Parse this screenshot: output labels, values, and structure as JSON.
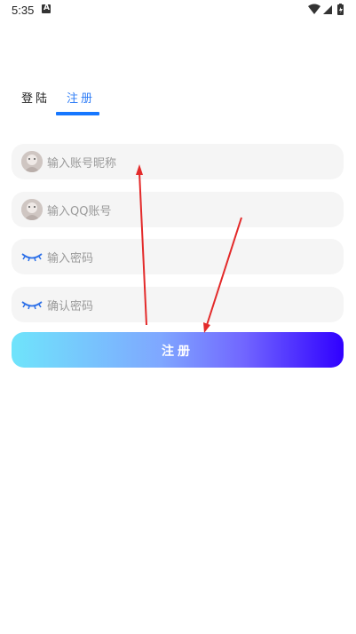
{
  "status_bar": {
    "time": "5:35",
    "notif": "A"
  },
  "tabs": {
    "login": "登陆",
    "register": "注册"
  },
  "form": {
    "nickname_placeholder": "输入账号昵称",
    "qq_placeholder": "输入QQ账号",
    "password_placeholder": "输入密码",
    "confirm_placeholder": "确认密码",
    "submit_label": "注册"
  },
  "colors": {
    "accent": "#1677ff",
    "arrow": "#e53935",
    "field_bg": "#f5f5f5"
  },
  "icons": [
    "avatar-icon",
    "avatar-icon",
    "closed-eye-icon",
    "closed-eye-icon",
    "wifi-icon",
    "signal-icon",
    "battery-icon"
  ]
}
